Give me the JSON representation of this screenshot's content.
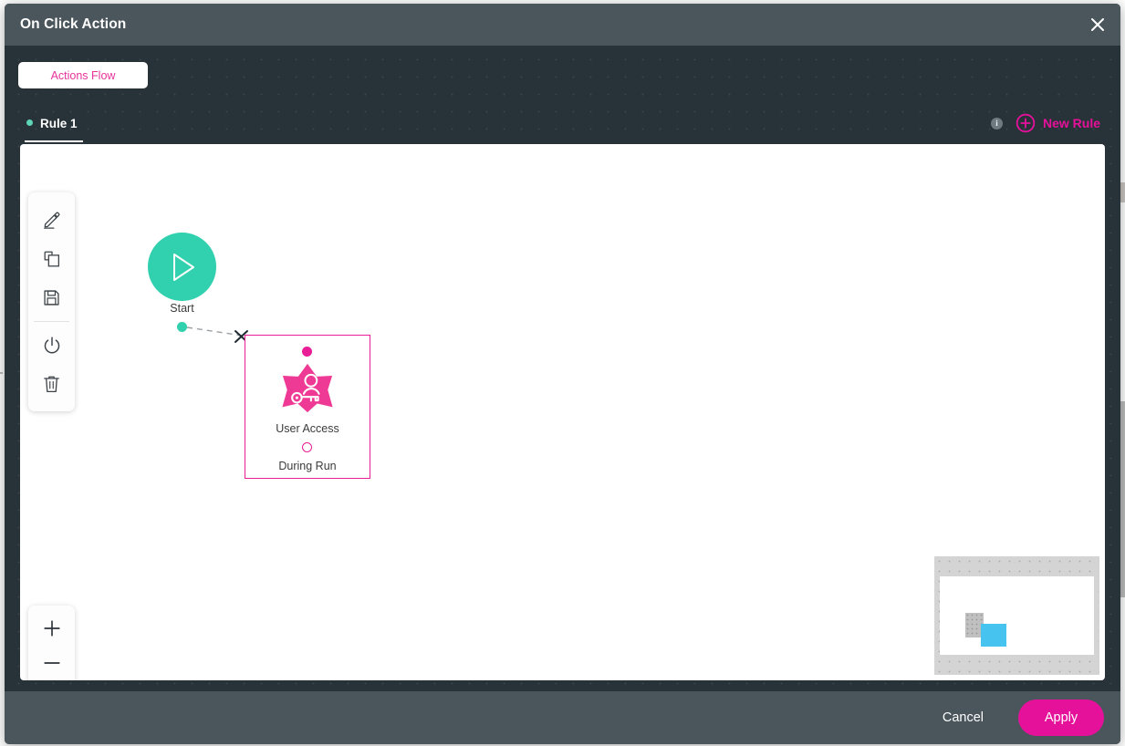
{
  "window": {
    "title": "On Click Action",
    "close_icon": "close-icon"
  },
  "toolbar": {
    "flow_tab_label": "Actions Flow"
  },
  "rules": {
    "active_rule_label": "Rule 1",
    "info_badge": "i",
    "new_rule_label": "New Rule"
  },
  "canvas": {
    "tools": [
      {
        "name": "edit-tool",
        "icon": "pencil-icon"
      },
      {
        "name": "duplicate-tool",
        "icon": "copy-icon"
      },
      {
        "name": "save-tool",
        "icon": "floppy-disk-icon"
      },
      {
        "name": "power-tool",
        "icon": "power-icon"
      },
      {
        "name": "delete-tool",
        "icon": "trash-icon"
      }
    ],
    "zoom_controls": [
      {
        "name": "zoom-in-button",
        "icon": "plus-icon"
      },
      {
        "name": "zoom-out-button",
        "icon": "minus-icon"
      },
      {
        "name": "fit-view-button",
        "icon": "fit-screen-icon"
      }
    ],
    "nodes": {
      "start": {
        "label": "Start",
        "icon": "play-icon",
        "color": "#31d0ae"
      },
      "action": {
        "title": "User Access",
        "subtitle": "During Run",
        "icon": "user-key-star-icon",
        "color": "#e91e96"
      }
    },
    "connection": {
      "style": "dashed",
      "marker": "x-delete-marker"
    }
  },
  "footer": {
    "cancel_label": "Cancel",
    "apply_label": "Apply"
  },
  "colors": {
    "header": "#4a555c",
    "body": "#283239",
    "accent_pink": "#e6119b",
    "accent_teal": "#31d0ae",
    "minimap_node": "#47c3ef"
  }
}
